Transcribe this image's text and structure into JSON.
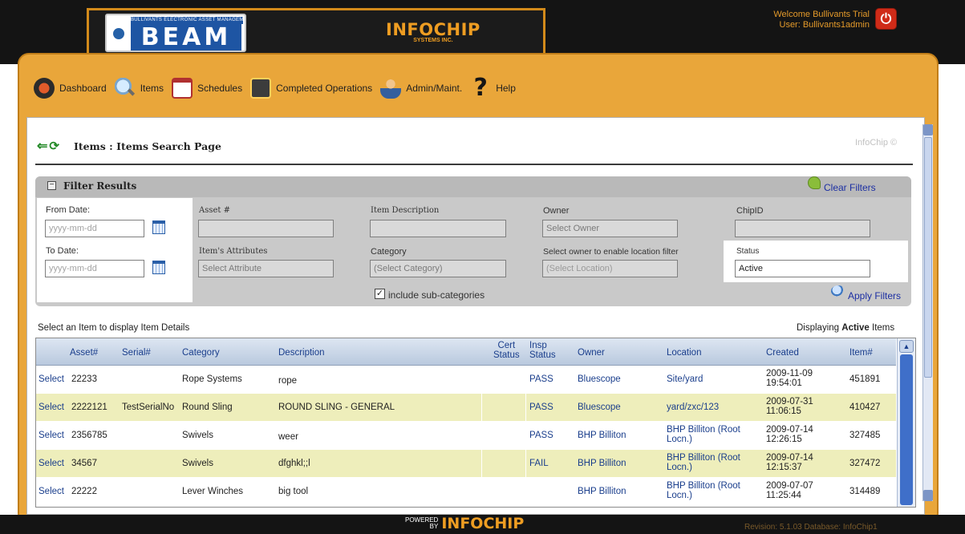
{
  "header": {
    "beam_logo_word": "BEAM",
    "beam_logo_strip": "BULLIVANTS ELECTRONIC ASSET MANAGEMENT",
    "infochip_logo": "INFOCHIP",
    "infochip_sub": "SYSTEMS INC.",
    "welcome_line1": "Welcome Bullivants Trial",
    "welcome_line2": "User: Bullivants1admin"
  },
  "nav": {
    "items": [
      {
        "label": "Dashboard",
        "icon": "dashboard-icon"
      },
      {
        "label": "Items",
        "icon": "magnifier-icon"
      },
      {
        "label": "Schedules",
        "icon": "calendar-icon"
      },
      {
        "label": "Completed Operations",
        "icon": "chart-board-icon"
      },
      {
        "label": "Admin/Maint.",
        "icon": "admin-person-icon"
      },
      {
        "label": "Help",
        "icon": "question-mark-icon"
      }
    ]
  },
  "page": {
    "title": "Items : Items Search Page",
    "brand_tag": "InfoChip ©"
  },
  "filter": {
    "title": "Filter Results",
    "clear_label": "Clear Filters",
    "apply_label": "Apply Filters",
    "from_date_label": "From Date:",
    "from_date_placeholder": "yyyy-mm-dd",
    "to_date_label": "To Date:",
    "to_date_placeholder": "yyyy-mm-dd",
    "asset_label": "Asset #",
    "asset_value": "",
    "attributes_label": "Item's Attributes",
    "attributes_value": "Select Attribute",
    "description_label": "Item Description",
    "description_value": "",
    "category_label": "Category",
    "category_value": "(Select Category)",
    "include_sub_label": "include sub-categories",
    "include_sub_checked": "✓",
    "owner_label": "Owner",
    "owner_value": "Select Owner",
    "location_hint": "Select owner to enable location filter",
    "location_value": "(Select Location)",
    "chipid_label": "ChipID",
    "chipid_value": "",
    "status_label": "Status",
    "status_value": "Active"
  },
  "list": {
    "hint": "Select an Item to display Item Details",
    "display_prefix": "Displaying",
    "display_bold": "Active",
    "display_suffix": "Items",
    "headers": {
      "asset": "Asset#",
      "serial": "Serial#",
      "category": "Category",
      "description": "Description",
      "cert_status_1": "Cert",
      "cert_status_2": "Status",
      "insp_status_1": "Insp",
      "insp_status_2": "Status",
      "owner": "Owner",
      "location": "Location",
      "created": "Created",
      "item": "Item#"
    },
    "rows": [
      {
        "select": "Select",
        "asset": "22233",
        "serial": "",
        "category": "Rope Systems",
        "description": "rope",
        "cert": "",
        "insp": "PASS",
        "owner": "Bluescope",
        "location": "Site/yard",
        "created1": "2009-11-09",
        "created2": "19:54:01",
        "item": "451891"
      },
      {
        "select": "Select",
        "asset": "2222121",
        "serial": "TestSerialNo",
        "category": "Round Sling",
        "description": "ROUND SLING - GENERAL",
        "cert": "",
        "insp": "PASS",
        "owner": "Bluescope",
        "location": "yard/zxc/123",
        "created1": "2009-07-31",
        "created2": "11:06:15",
        "item": "410427"
      },
      {
        "select": "Select",
        "asset": "2356785",
        "serial": "",
        "category": "Swivels",
        "description": "weer",
        "cert": "",
        "insp": "PASS",
        "owner": "BHP Billiton",
        "location": "BHP Billiton (Root Locn.)",
        "created1": "2009-07-14",
        "created2": "12:26:15",
        "item": "327485"
      },
      {
        "select": "Select",
        "asset": "34567",
        "serial": "",
        "category": "Swivels",
        "description": "dfghkl;;l",
        "cert": "",
        "insp": "FAIL",
        "owner": "BHP Billiton",
        "location": "BHP Billiton (Root Locn.)",
        "created1": "2009-07-14",
        "created2": "12:15:37",
        "item": "327472"
      },
      {
        "select": "Select",
        "asset": "22222",
        "serial": "",
        "category": "Lever Winches",
        "description": "big tool",
        "cert": "",
        "insp": "",
        "owner": "BHP Billiton",
        "location": "BHP Billiton (Root Locn.)",
        "created1": "2009-07-07",
        "created2": "11:25:44",
        "item": "314489"
      }
    ]
  },
  "footer": {
    "powered_1": "POWERED",
    "powered_2": "BY",
    "brand": "INFOCHIP",
    "revision": "Revision: 5.1.03   Database: InfoChip1"
  },
  "colors": {
    "frame_orange": "#e9a63a",
    "link_blue": "#1a3e8c",
    "row_highlight": "#eeeebb"
  }
}
